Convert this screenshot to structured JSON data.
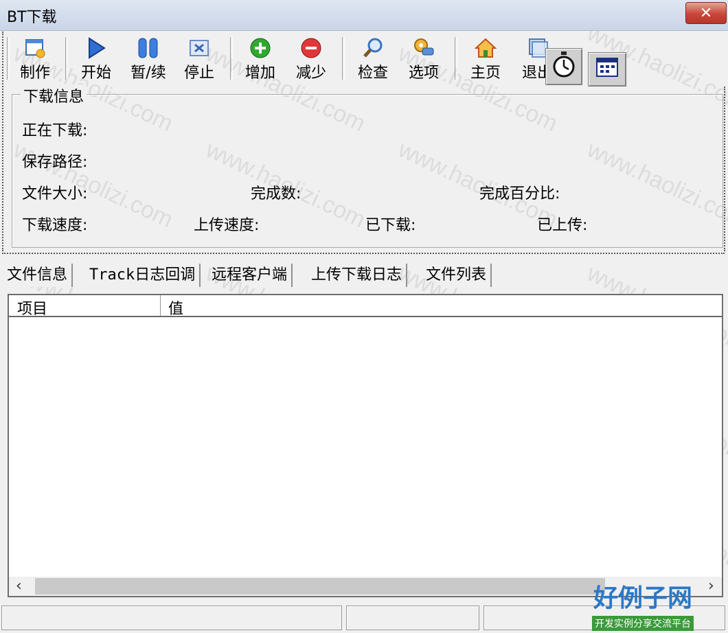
{
  "window": {
    "title": "BT下载",
    "close_glyph": "✕"
  },
  "toolbar": {
    "items": [
      {
        "label": "制作",
        "icon": "window-gear-icon"
      },
      {
        "label": "开始",
        "icon": "play-icon"
      },
      {
        "label": "暂/续",
        "icon": "pause-icon"
      },
      {
        "label": "停止",
        "icon": "stop-icon"
      },
      {
        "label": "增加",
        "icon": "plus-circle-icon"
      },
      {
        "label": "减少",
        "icon": "minus-circle-icon"
      },
      {
        "label": "检查",
        "icon": "magnifier-icon"
      },
      {
        "label": "选项",
        "icon": "options-icon"
      },
      {
        "label": "主页",
        "icon": "home-icon"
      },
      {
        "label": "退出",
        "icon": "exit-icon"
      }
    ],
    "extra_buttons": [
      {
        "icon": "stopwatch-icon"
      },
      {
        "icon": "calendar-window-icon"
      }
    ]
  },
  "download_info": {
    "title": "下载信息",
    "downloading_label": "正在下载:",
    "save_path_label": "保存路径:",
    "file_size_label": "文件大小:",
    "completed_count_label": "完成数:",
    "completed_percent_label": "完成百分比:",
    "download_speed_label": "下载速度:",
    "upload_speed_label": "上传速度:",
    "downloaded_label": "已下载:",
    "uploaded_label": "已上传:"
  },
  "tabs": [
    {
      "label": "文件信息",
      "active": true
    },
    {
      "label": "Track日志回调",
      "active": false
    },
    {
      "label": "远程客户端",
      "active": false
    },
    {
      "label": "上传下载日志",
      "active": false
    },
    {
      "label": "文件列表",
      "active": false
    }
  ],
  "list": {
    "columns": [
      "项目",
      "值"
    ],
    "rows": []
  },
  "watermark": {
    "text": "www.haolizi.com"
  },
  "logo": {
    "main": "好例子网",
    "sub": "开发实例分享交流平台"
  }
}
